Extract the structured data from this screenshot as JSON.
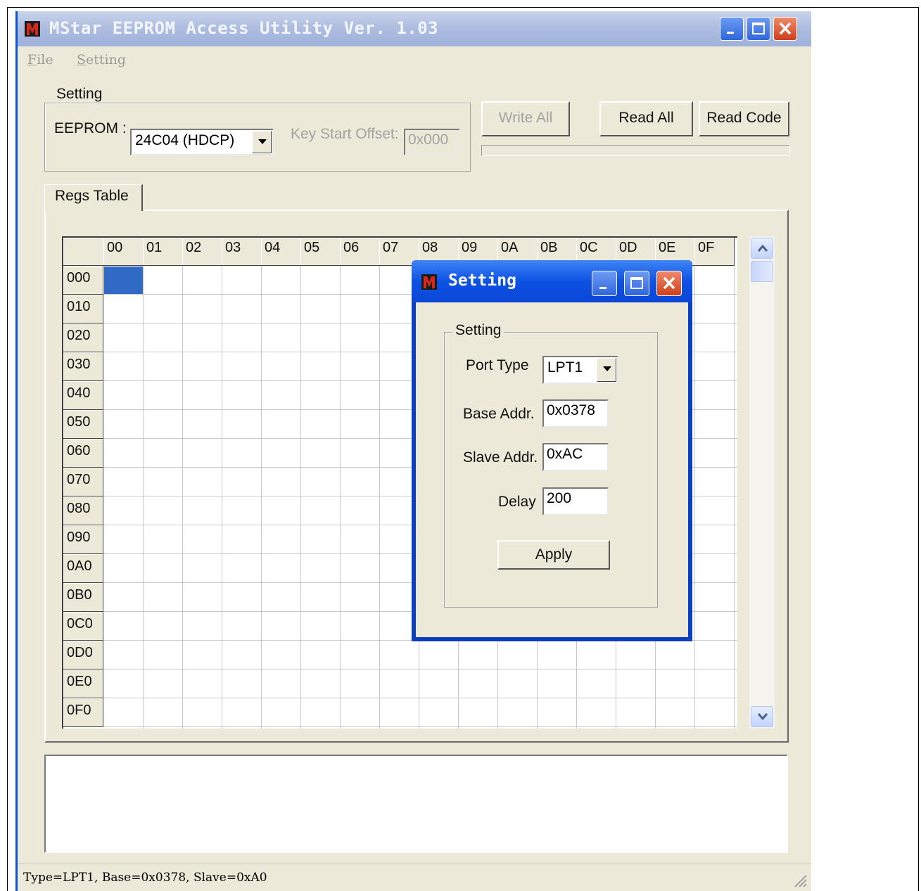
{
  "window": {
    "title": "MStar EEPROM Access Utility Ver. 1.03",
    "menu": [
      {
        "accel": "F",
        "rest": "ile"
      },
      {
        "accel": "S",
        "rest": "etting"
      }
    ]
  },
  "settings_group": {
    "label": "Setting",
    "eeprom_label": "EEPROM :",
    "eeprom_value": "24C04 (HDCP)",
    "key_offset_label": "Key Start Offset:",
    "key_offset_value": "0x000"
  },
  "buttons": {
    "write_all": "Write All",
    "read_all": "Read All",
    "read_code": "Read Code"
  },
  "tab": {
    "label": "Regs Table"
  },
  "grid": {
    "columns": [
      "00",
      "01",
      "02",
      "03",
      "04",
      "05",
      "06",
      "07",
      "08",
      "09",
      "0A",
      "0B",
      "0C",
      "0D",
      "0E",
      "0F"
    ],
    "rows": [
      "000",
      "010",
      "020",
      "030",
      "040",
      "050",
      "060",
      "070",
      "080",
      "090",
      "0A0",
      "0B0",
      "0C0",
      "0D0",
      "0E0",
      "0F0"
    ],
    "selected_cell": {
      "row": "000",
      "col": "00"
    }
  },
  "status": {
    "text": "Type=LPT1,  Base=0x0378,  Slave=0xA0"
  },
  "dialog": {
    "title": "Setting",
    "group_label": "Setting",
    "port_type_label": "Port Type",
    "port_type_value": "LPT1",
    "base_addr_label": "Base Addr.",
    "base_addr_value": "0x0378",
    "slave_addr_label": "Slave Addr.",
    "slave_addr_value": "0xAC",
    "delay_label": "Delay",
    "delay_value": "200",
    "apply_label": "Apply"
  },
  "colors": {
    "selection": "#316ac5",
    "dialog_border": "#0a3fc4",
    "face": "#ece9d8"
  }
}
